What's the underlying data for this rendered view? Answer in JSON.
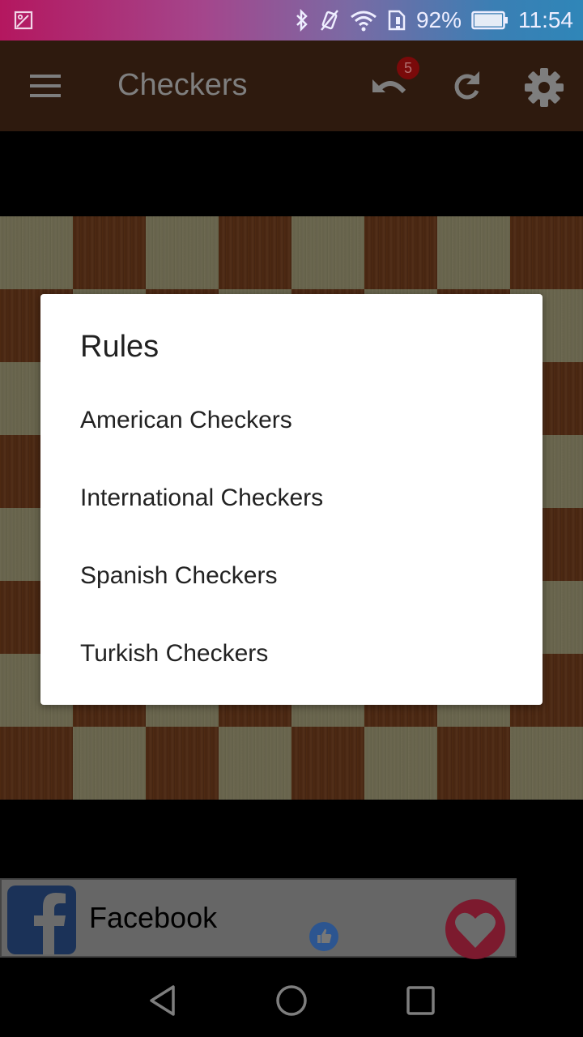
{
  "status_bar": {
    "notification_icon": "image-icon",
    "icons": [
      "bluetooth-icon",
      "vibrate-off-icon",
      "wifi-icon",
      "sim-alert-icon",
      "battery-icon"
    ],
    "battery": "92%",
    "time": "11:54"
  },
  "app_bar": {
    "menu_icon": "menu-icon",
    "title": "Checkers",
    "undo_icon": "undo-icon",
    "undo_badge": "5",
    "refresh_icon": "refresh-icon",
    "settings_icon": "gear-icon"
  },
  "board": {
    "rows": 8,
    "cols": 8,
    "top_left_square": "light",
    "colors": {
      "light": "#6b6750",
      "dark": "#4a2812"
    }
  },
  "dialog": {
    "title": "Rules",
    "items": [
      {
        "label": "American Checkers"
      },
      {
        "label": "International Checkers"
      },
      {
        "label": "Spanish Checkers"
      },
      {
        "label": "Turkish Checkers"
      }
    ]
  },
  "ad_banner": {
    "logo_icon": "facebook-logo-icon",
    "name": "Facebook",
    "like_icon": "thumbs-up-icon",
    "heart_icon": "heart-icon",
    "colors": {
      "facebook_blue": "#1b3258",
      "heart": "#7c1a2e"
    }
  },
  "nav_bar": {
    "back_icon": "back-icon",
    "home_icon": "home-icon",
    "recents_icon": "recents-icon"
  }
}
